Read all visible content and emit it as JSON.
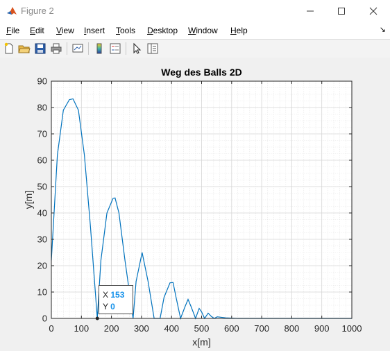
{
  "window": {
    "title": "Figure 2",
    "controls": [
      "minimize-icon",
      "maximize-icon",
      "close-icon"
    ]
  },
  "menu": {
    "items": [
      {
        "key": "F",
        "rest": "ile"
      },
      {
        "key": "E",
        "rest": "dit"
      },
      {
        "key": "V",
        "rest": "iew"
      },
      {
        "key": "I",
        "rest": "nsert"
      },
      {
        "key": "T",
        "rest": "ools"
      },
      {
        "key": "D",
        "rest": "esktop"
      },
      {
        "key": "W",
        "rest": "indow"
      },
      {
        "key": "H",
        "rest": "elp"
      }
    ],
    "dock_arrow": "↘"
  },
  "toolbar": {
    "buttons": [
      "new-figure-icon",
      "open-icon",
      "save-icon",
      "print-icon",
      "link-plot-icon",
      "colorbar-icon",
      "legend-icon",
      "pointer-icon",
      "property-inspector-icon"
    ]
  },
  "chart_data": {
    "type": "line",
    "title": "Weg des Balls 2D",
    "xlabel": "x[m]",
    "ylabel": "y[m]",
    "xlim": [
      0,
      1000
    ],
    "ylim": [
      0,
      90
    ],
    "xticks": [
      0,
      100,
      200,
      300,
      400,
      500,
      600,
      700,
      800,
      900,
      1000
    ],
    "yticks": [
      0,
      10,
      20,
      30,
      40,
      50,
      60,
      70,
      80,
      90
    ],
    "grid": true,
    "minor_grid": true,
    "line_color": "#0072bd",
    "series": [
      {
        "x": [
          0,
          20,
          40,
          60,
          72,
          90,
          110,
          130,
          153,
          165,
          185,
          205,
          212,
          225,
          245,
          272,
          282,
          302,
          322,
          342,
          362,
          375,
          395,
          405,
          415,
          430,
          445,
          455,
          465,
          480,
          492,
          500,
          510,
          522,
          532,
          542,
          552,
          580,
          620,
          700,
          800,
          900,
          1000
        ],
        "y": [
          22,
          62,
          79,
          83,
          83.3,
          79,
          62,
          35,
          0,
          22,
          40,
          45.5,
          45.7,
          40,
          22,
          0,
          14,
          25,
          14,
          0,
          0,
          8,
          13.5,
          13.6,
          8,
          0,
          4.5,
          7.2,
          4.5,
          0,
          3.8,
          2.5,
          0,
          2,
          0.8,
          0,
          0.6,
          0.2,
          0,
          0,
          0,
          0,
          0
        ]
      }
    ],
    "datatip": {
      "x_label": "X",
      "x_value": "153",
      "y_label": "Y",
      "y_value": "0",
      "x": 153,
      "y": 0
    }
  }
}
